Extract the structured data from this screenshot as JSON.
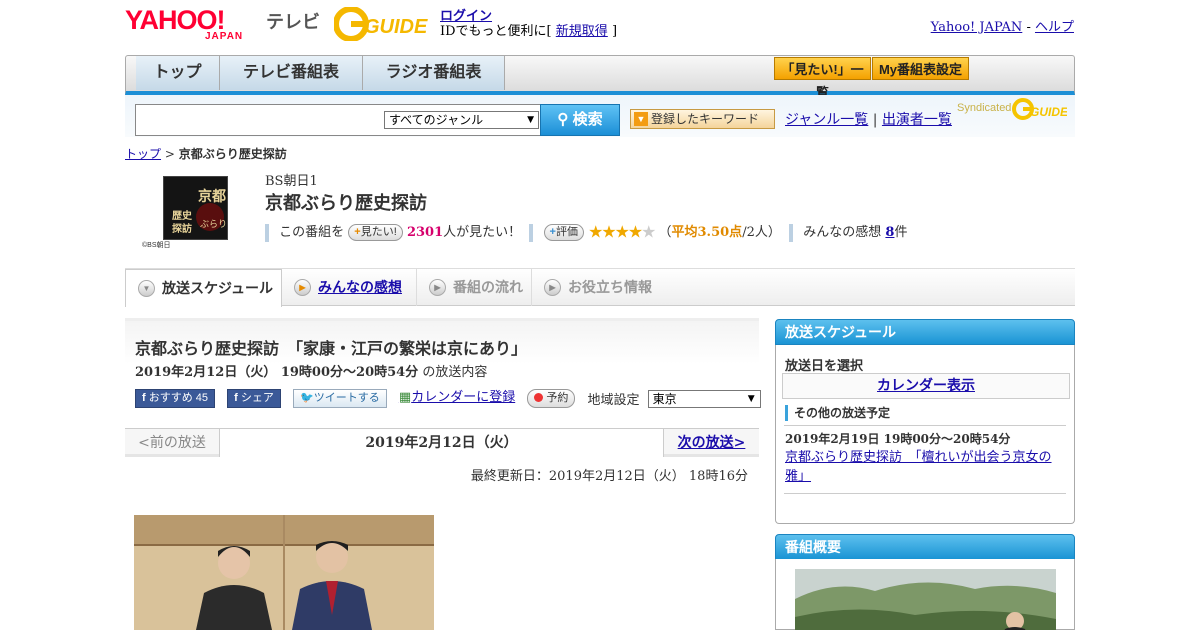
{
  "header": {
    "yahoo_logo": "YAHOO!",
    "yahoo_japan": "JAPAN",
    "tv_label": "テレビ",
    "gguide_logo": "GUIDE",
    "login_link": "ログイン",
    "login_text_prefix": "IDでもっと便利に[",
    "register_link": "新規取得",
    "login_text_suffix": "]",
    "yahoo_japan_link": "Yahoo! JAPAN",
    "separator": "-",
    "help_link": "ヘルプ"
  },
  "nav": {
    "tabs": [
      "トップ",
      "テレビ番組表",
      "ラジオ番組表"
    ],
    "watchlist_button": "「見たい!」一覧",
    "my_schedule_button": "My番組表設定"
  },
  "search": {
    "genre_selected": "すべてのジャンル",
    "search_button": "検索",
    "keyword_button": "登録したキーワード",
    "genre_list_link": "ジャンル一覧",
    "link_separator": "|",
    "performer_list_link": "出演者一覧",
    "syndicated_label": "Syndicated",
    "syndicated_logo": "GUIDE"
  },
  "breadcrumb": {
    "top_link": "トップ",
    "separator": ">",
    "current": "京都ぶらり歴史探訪"
  },
  "program": {
    "thumb_text": "京都ぶらり歴史探訪",
    "thumb_credit": "©BS朝日",
    "channel": "BS朝日1",
    "title": "京都ぶらり歴史探訪",
    "want_prefix": "この番組を",
    "want_button": "見たい!",
    "want_count": "2301",
    "want_suffix": "人が見たい！",
    "rate_button": "評価",
    "rating_open": "（",
    "rating_avg": "平均3.50点",
    "rating_count": "/2人）",
    "rating_value": 3.5,
    "reviews_prefix": "みんなの感想",
    "reviews_count": "8",
    "reviews_suffix": "件"
  },
  "tabs": [
    {
      "label": "放送スケジュール",
      "state": "active"
    },
    {
      "label": "みんなの感想",
      "state": "link"
    },
    {
      "label": "番組の流れ",
      "state": "disabled"
    },
    {
      "label": "お役立ち情報",
      "state": "disabled"
    }
  ],
  "episode": {
    "title": "京都ぶらり歴史探訪　「家康・江戸の繁栄は京にあり」",
    "time_bold": "2019年2月12日（火） 19時00分～20時54分",
    "time_suffix": "の放送内容",
    "fb_recommend": "おすすめ 45",
    "fb_share": "シェア",
    "tweet": "ツイートする",
    "calendar_link": "カレンダーに登録",
    "reserve_button": "予約",
    "region_label": "地域設定",
    "region_selected": "東京",
    "prev": "<前の放送",
    "current_date": "2019年2月12日（火）",
    "next": "次の放送>",
    "updated": "最終更新日：2019年2月12日（火） 18時16分"
  },
  "sidebar": {
    "schedule_head": "放送スケジュール",
    "select_date": "放送日を選択",
    "calendar_button": "カレンダー表示",
    "other_head": "その他の放送予定",
    "other_time": "2019年2月19日 19時00分～20時54分",
    "other_link": "京都ぶらり歴史探訪　「檀れいが出会う京女の雅」",
    "summary_head": "番組概要"
  },
  "colors": {
    "accent_blue": "#1c8fd6",
    "yahoo_red": "#ff0033",
    "gguide_yellow": "#f5b800",
    "want_red": "#d6006c",
    "rating_orange": "#e08a00"
  }
}
